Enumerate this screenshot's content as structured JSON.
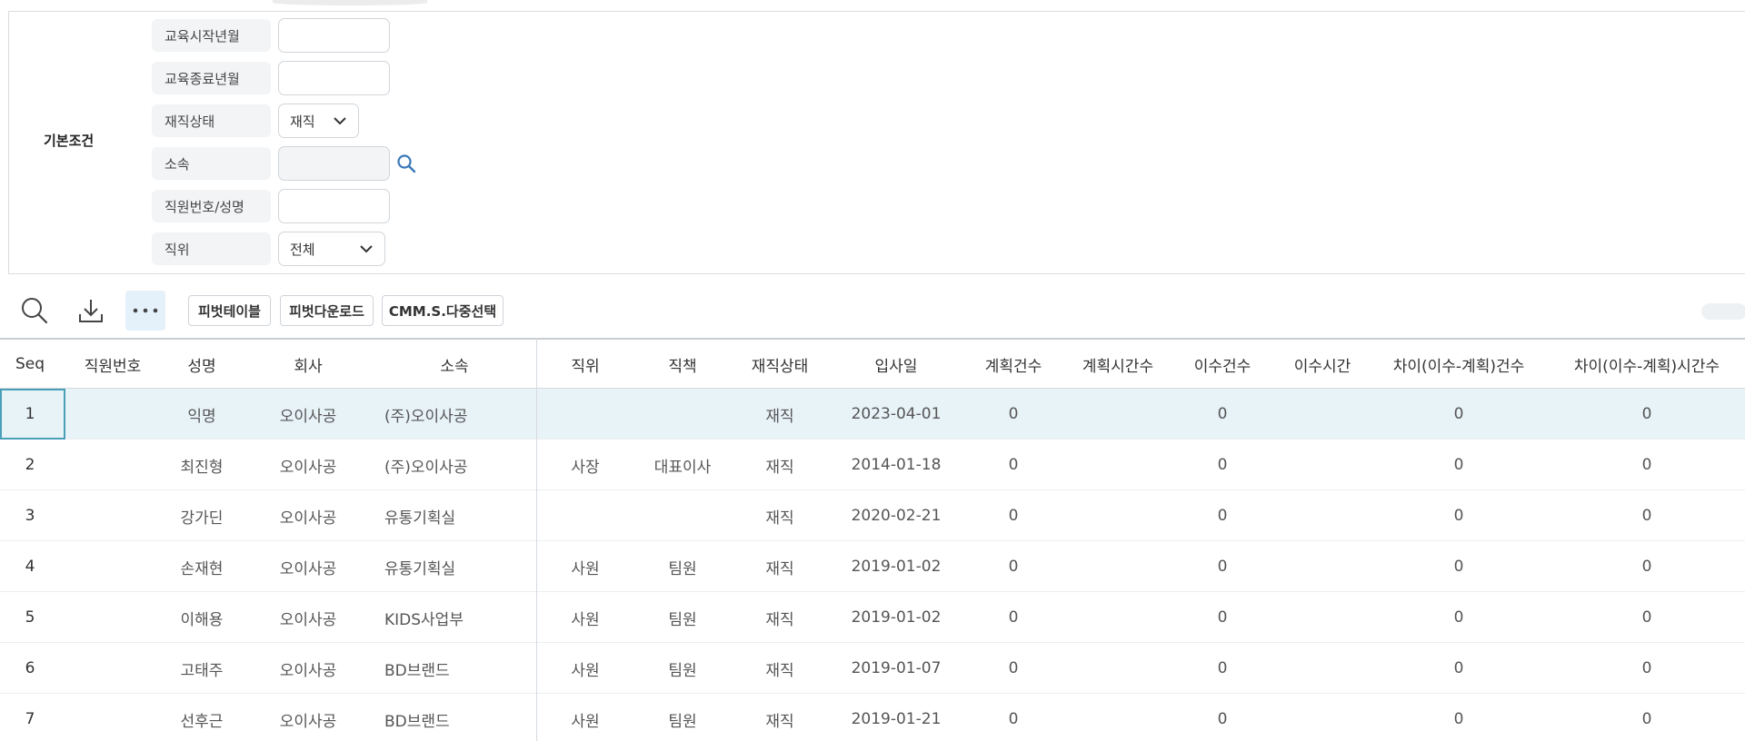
{
  "filter": {
    "section_label": "기본조건",
    "fields": {
      "edu_start": {
        "label": "교육시작년월",
        "value": ""
      },
      "edu_end": {
        "label": "교육종료년월",
        "value": ""
      },
      "emp_status": {
        "label": "재직상태",
        "value": "재직"
      },
      "department": {
        "label": "소속",
        "value": ""
      },
      "emp_id_name": {
        "label": "직원번호/성명",
        "value": ""
      },
      "position": {
        "label": "직위",
        "value": "전체"
      }
    }
  },
  "toolbar": {
    "buttons": {
      "pivot_table": "피벗테이블",
      "pivot_download": "피벗다운로드",
      "multi_select": "CMM.S.다중선택"
    }
  },
  "grid": {
    "columns": [
      "Seq",
      "직원번호",
      "성명",
      "회사",
      "소속",
      "직위",
      "직책",
      "재직상태",
      "입사일",
      "계획건수",
      "계획시간수",
      "이수건수",
      "이수시간",
      "차이(이수-계획)건수",
      "차이(이수-계획)시간수"
    ],
    "rows": [
      [
        "1",
        "",
        "익명",
        "오이사공",
        "(주)오이사공",
        "",
        "",
        "재직",
        "2023-04-01",
        "0",
        "",
        "0",
        "",
        "0",
        "0"
      ],
      [
        "2",
        "",
        "최진형",
        "오이사공",
        "(주)오이사공",
        "사장",
        "대표이사",
        "재직",
        "2014-01-18",
        "0",
        "",
        "0",
        "",
        "0",
        "0"
      ],
      [
        "3",
        "",
        "강가딘",
        "오이사공",
        "유통기획실",
        "",
        "",
        "재직",
        "2020-02-21",
        "0",
        "",
        "0",
        "",
        "0",
        "0"
      ],
      [
        "4",
        "",
        "손재현",
        "오이사공",
        "유통기획실",
        "사원",
        "팀원",
        "재직",
        "2019-01-02",
        "0",
        "",
        "0",
        "",
        "0",
        "0"
      ],
      [
        "5",
        "",
        "이해용",
        "오이사공",
        "KIDS사업부",
        "사원",
        "팀원",
        "재직",
        "2019-01-02",
        "0",
        "",
        "0",
        "",
        "0",
        "0"
      ],
      [
        "6",
        "",
        "고태주",
        "오이사공",
        "BD브랜드",
        "사원",
        "팀원",
        "재직",
        "2019-01-07",
        "0",
        "",
        "0",
        "",
        "0",
        "0"
      ],
      [
        "7",
        "",
        "선후근",
        "오이사공",
        "BD브랜드",
        "사원",
        "팀원",
        "재직",
        "2019-01-21",
        "0",
        "",
        "0",
        "",
        "0",
        "0"
      ]
    ],
    "selected_row": 0
  },
  "icons": {
    "search": "search-icon",
    "download": "download-icon",
    "more": "more-icon",
    "chevron": "chevron-down-icon",
    "dept_search": "search-icon"
  },
  "colors": {
    "selected_row": "#e8f3f8",
    "focus_border": "#4a9fb8",
    "label_bg": "#f2f4f6",
    "search_icon": "#3a78b8"
  }
}
